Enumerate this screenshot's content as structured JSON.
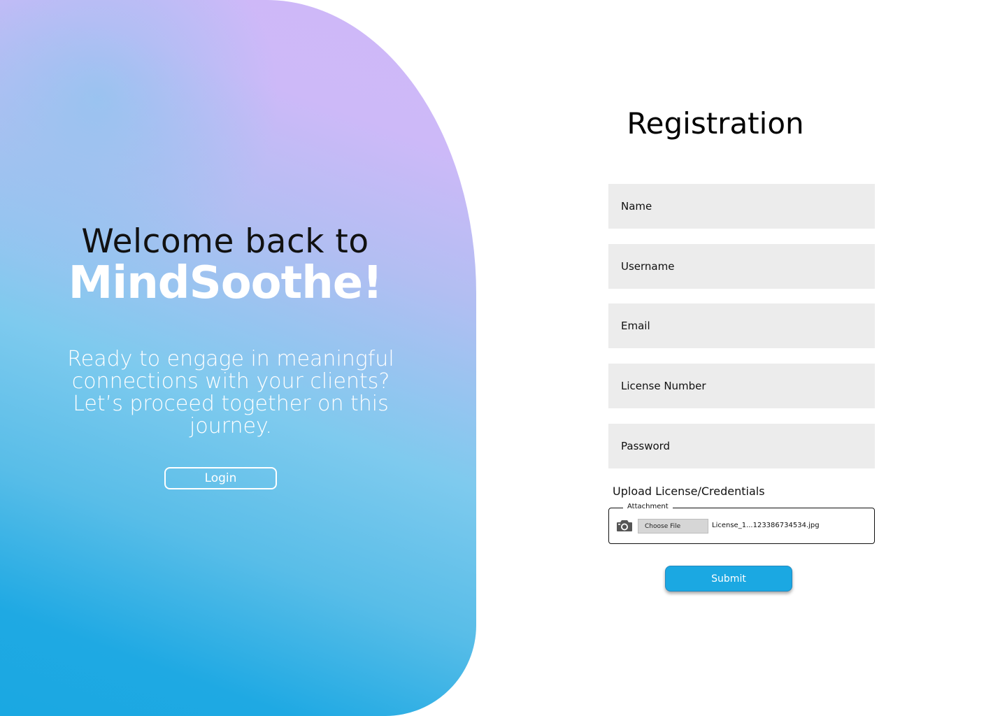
{
  "hero": {
    "title_line1": "Welcome back to",
    "title_line2": "MindSoothe!",
    "text": "Ready to engage in meaningful connections with your clients? Let’s proceed together on this journey.",
    "login_label": "Login"
  },
  "form": {
    "title": "Registration",
    "fields": [
      {
        "placeholder": "Name"
      },
      {
        "placeholder": "Username"
      },
      {
        "placeholder": "Email"
      },
      {
        "placeholder": "License Number"
      },
      {
        "placeholder": "Password"
      }
    ],
    "upload_label": "Upload License/Credentials",
    "attachment_legend": "Attachment",
    "choose_file_label": "Choose File",
    "file_name": "License_1...123386734534.jpg",
    "submit_label": "Submit"
  },
  "icons": {
    "camera": "camera-icon"
  },
  "colors": {
    "accent": "#1ba8e2",
    "gradient_top": "#cfb8f8",
    "gradient_bottom": "#1aa8e2",
    "field_bg": "#ececec"
  }
}
